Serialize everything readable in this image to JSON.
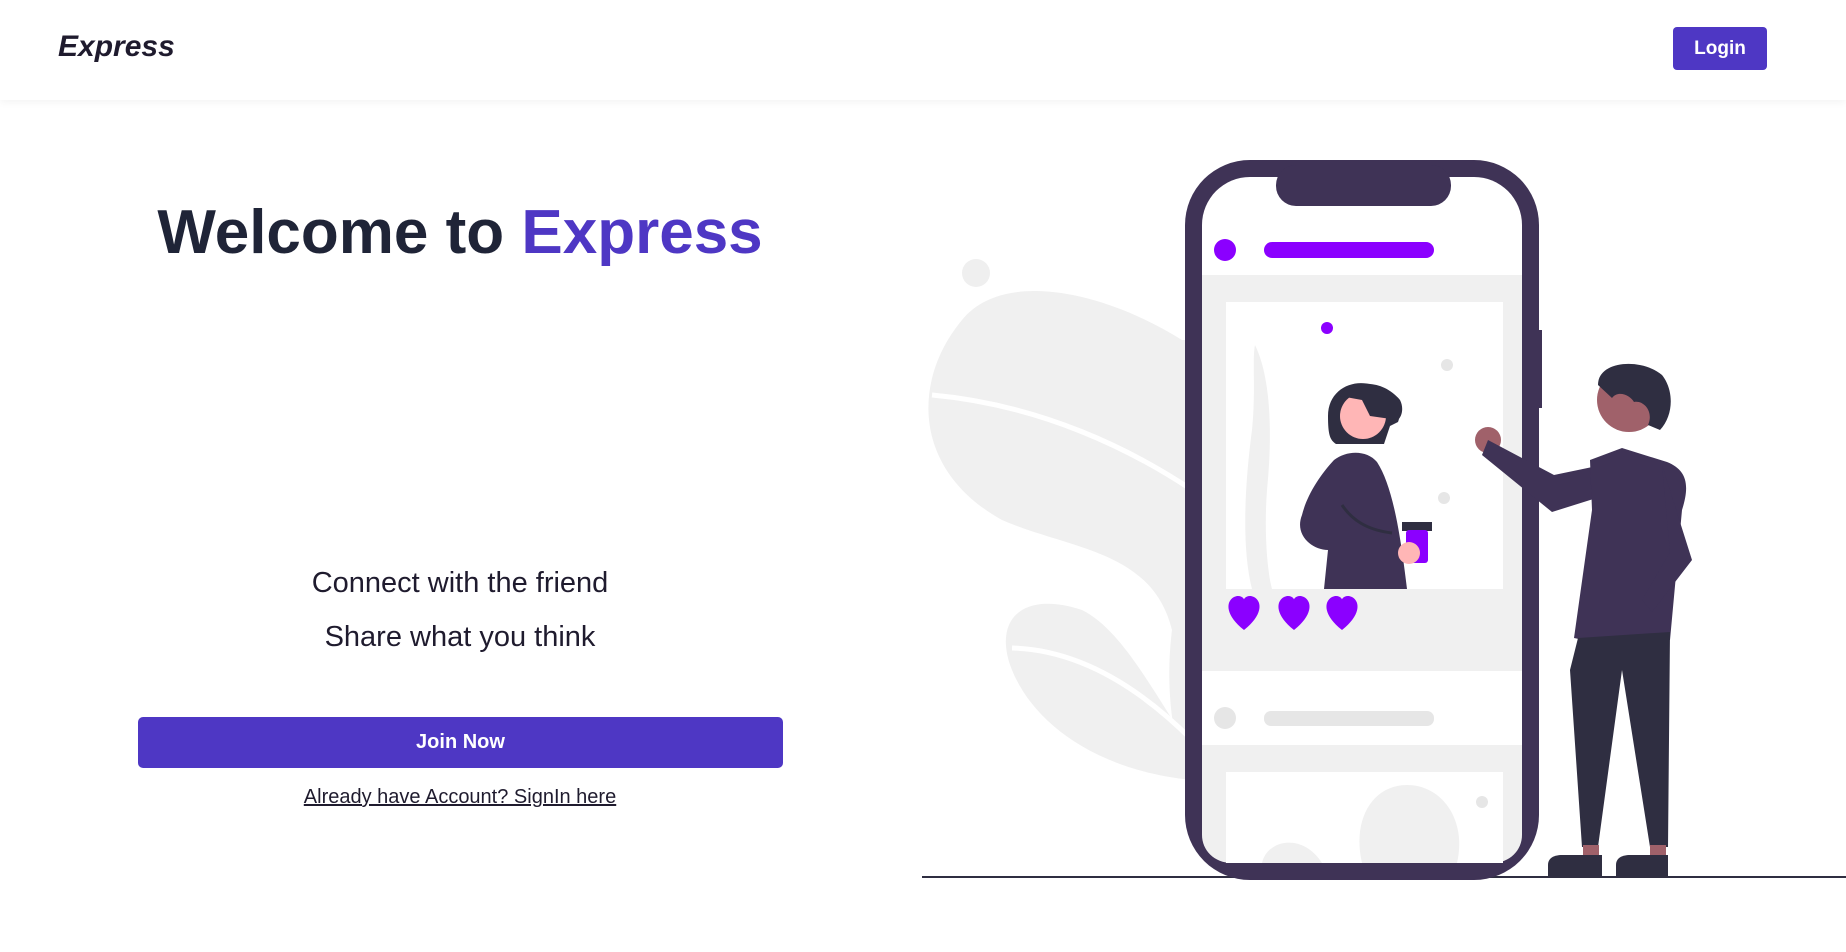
{
  "header": {
    "brand": "Express",
    "login_label": "Login"
  },
  "hero": {
    "title_prefix": "Welcome to",
    "title_accent": "Express",
    "taglines": [
      "Connect with the friend",
      "Share what you think"
    ],
    "join_label": "Join Now",
    "signin_link": "Already have Account? SignIn here"
  },
  "colors": {
    "accent": "#4e37c4",
    "illustration_accent": "#8b00ff",
    "phone_frame": "#3f3356",
    "text_dark": "#1f2437"
  },
  "illustration": {
    "subject": "phone-social-feed-illustration",
    "hearts": 3
  }
}
